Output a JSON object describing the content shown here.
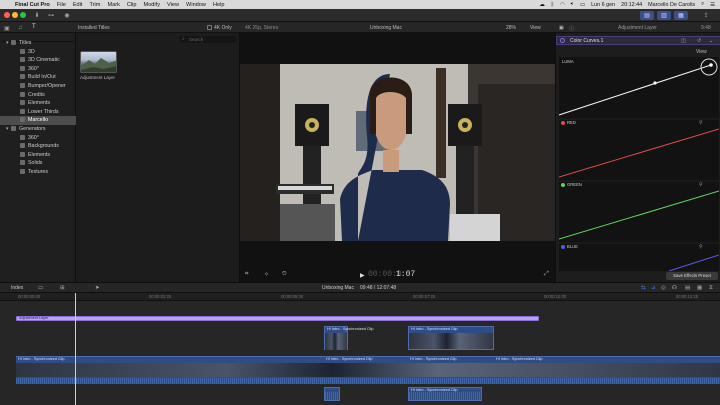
{
  "menubar": {
    "app": "Final Cut Pro",
    "items": [
      "File",
      "Edit",
      "Trim",
      "Mark",
      "Clip",
      "Modify",
      "View",
      "Window",
      "Help"
    ],
    "date": "Lun 6 gen",
    "time": "20:12:44",
    "user": "Marcello De Carolis"
  },
  "library": {
    "header": "Installed Titles",
    "toggle_label": "4K Only",
    "search_placeholder": "Search",
    "sidebar": [
      {
        "label": "Titles",
        "group": true
      },
      {
        "label": "3D"
      },
      {
        "label": "3D Cinematic"
      },
      {
        "label": "360°"
      },
      {
        "label": "Build In/Out"
      },
      {
        "label": "Bumper/Opener"
      },
      {
        "label": "Credits"
      },
      {
        "label": "Elements"
      },
      {
        "label": "Lower Thirds"
      },
      {
        "label": "Marcello",
        "selected": true
      },
      {
        "label": "Generators",
        "group": true
      },
      {
        "label": "360°"
      },
      {
        "label": "Backgrounds"
      },
      {
        "label": "Elements"
      },
      {
        "label": "Solids"
      },
      {
        "label": "Textures"
      }
    ],
    "thumb_label": "Adjustment Layer"
  },
  "viewer": {
    "format": "4K 25p, Stereo",
    "project": "Unboxing Mac",
    "zoom": "28%",
    "view_menu": "View",
    "timecode_dim": "00:00:0",
    "timecode_bright": "1:07"
  },
  "inspector": {
    "title": "Adjustment Layer",
    "duration": "9:48",
    "effect": "Color Curves 1",
    "view_menu": "View",
    "curves": [
      {
        "label": "LUMA",
        "color": "#ffffff"
      },
      {
        "label": "RED",
        "color": "#e04a4a"
      },
      {
        "label": "GREEN",
        "color": "#5fd35f"
      },
      {
        "label": "BLUE",
        "color": "#5a5ae8"
      }
    ],
    "save_button": "Save Effects Preset"
  },
  "timeline": {
    "index_label": "Index",
    "project": "Unboxing Mac",
    "duration": "09:48 / 12:07:48",
    "ruler": [
      "00:00:00:00",
      "00:00:02:25",
      "00:00:05:00",
      "00:00:07:25",
      "00:00:10:00",
      "00:00:12:25"
    ],
    "adjustment_clip": "Adjustment Layer",
    "clip_title": "HI Intro - Synchronized Clip",
    "main_clip": "HI Intro - Synchronized Clip"
  },
  "colors": {
    "accent": "#8a6fd6",
    "adjustment": "#b9a3ea",
    "clip_blue": "#2f4c87",
    "playhead": "#cfcfcf"
  }
}
